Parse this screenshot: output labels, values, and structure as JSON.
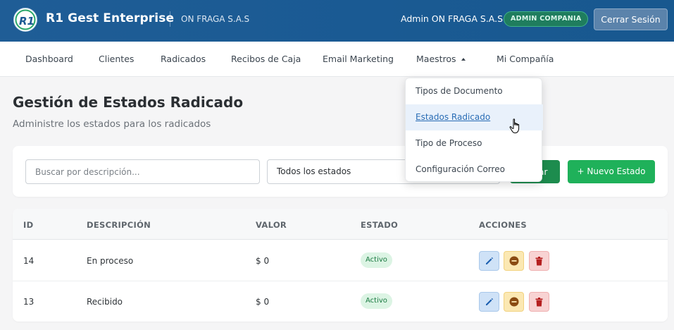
{
  "header": {
    "brand": "R1 Gest Enterprise",
    "company": "ON FRAGA S.A.S",
    "user": "Admin ON FRAGA S.A.S",
    "role_badge": "ADMIN COMPANIA",
    "logout_label": "Cerrar Sesión",
    "logo_icon": "r1-logo-icon"
  },
  "nav": {
    "items": [
      {
        "label": "Dashboard"
      },
      {
        "label": "Clientes"
      },
      {
        "label": "Radicados"
      },
      {
        "label": "Recibos de Caja"
      },
      {
        "label": "Email Marketing"
      },
      {
        "label": "Maestros",
        "expanded": true
      },
      {
        "label": "Mi Compañía"
      }
    ]
  },
  "dropdown": {
    "items": [
      {
        "label": "Tipos de Documento"
      },
      {
        "label": "Estados Radicado",
        "active": true
      },
      {
        "label": "Tipo de Proceso"
      },
      {
        "label": "Configuración Correo"
      }
    ]
  },
  "page": {
    "title": "Gestión de Estados Radicado",
    "subtitle": "Administre los estados para los radicados"
  },
  "filters": {
    "search_placeholder": "Buscar por descripción...",
    "search_value": "",
    "status_selected": "Todos los estados",
    "filter_label": "Filtrar",
    "new_label": "+ Nuevo Estado"
  },
  "table": {
    "columns": [
      "ID",
      "DESCRIPCIÓN",
      "VALOR",
      "ESTADO",
      "ACCIONES"
    ],
    "rows": [
      {
        "id": "14",
        "descripcion": "En proceso",
        "valor": "$ 0",
        "estado": "Activo"
      },
      {
        "id": "13",
        "descripcion": "Recibido",
        "valor": "$ 0",
        "estado": "Activo"
      }
    ]
  },
  "colors": {
    "header_bg": "#1f5d96",
    "primary_green": "#1fb15a",
    "active_link": "#2a6db5"
  }
}
